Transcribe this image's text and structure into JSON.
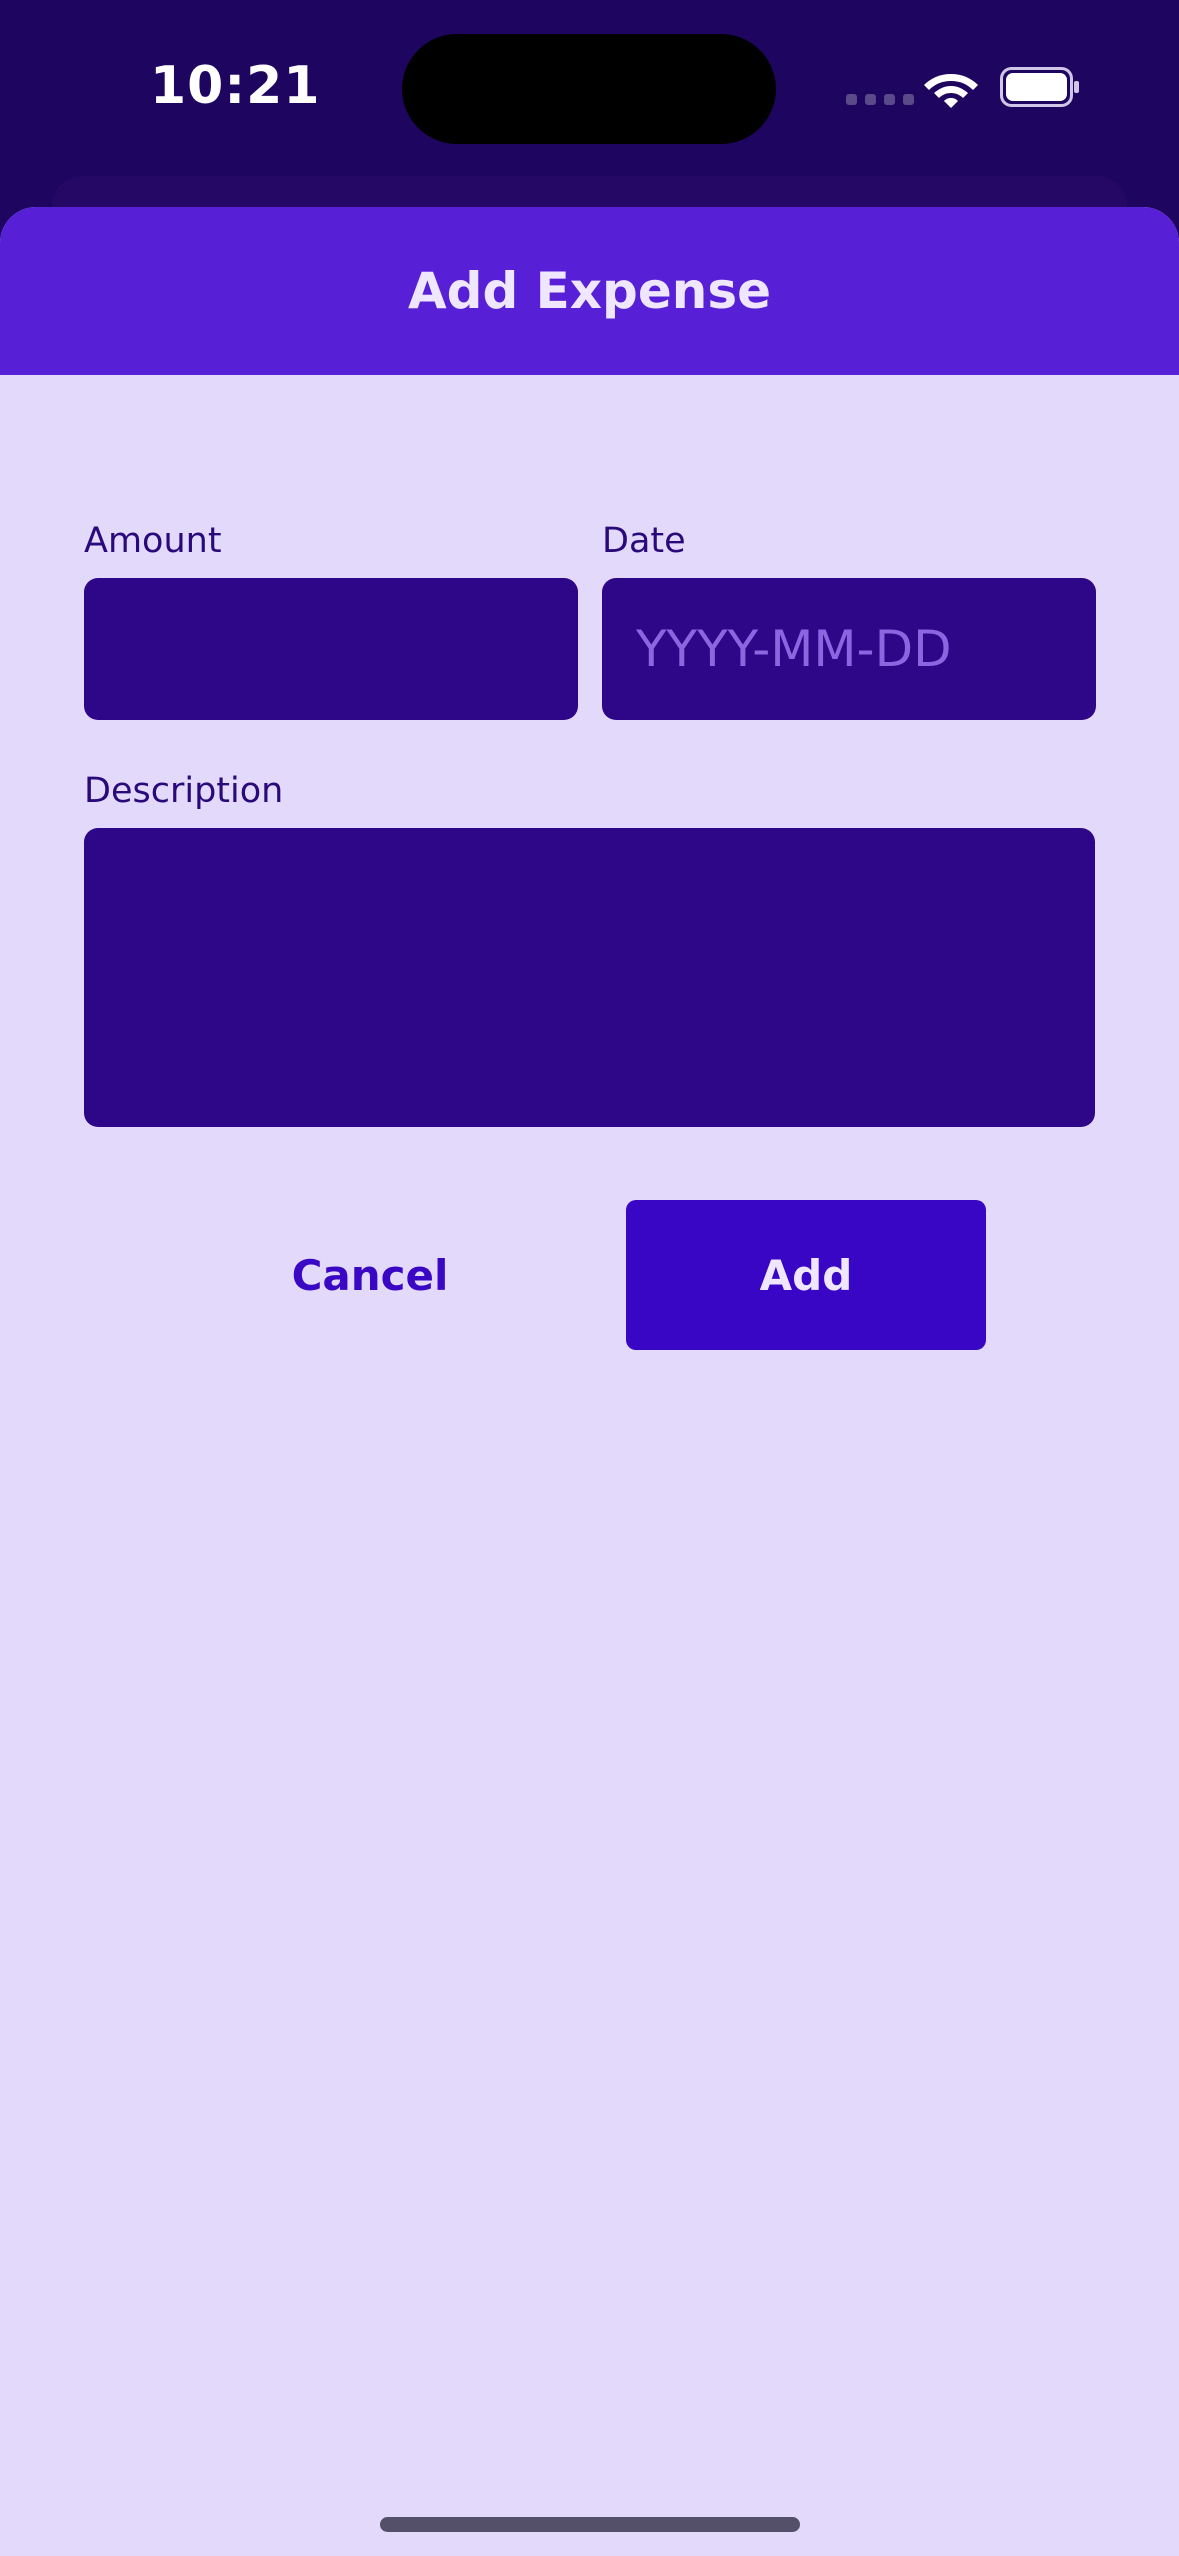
{
  "status_bar": {
    "time": "10:21",
    "wifi_icon": "wifi-icon",
    "battery_icon": "battery-icon"
  },
  "sheet": {
    "title": "Add Expense"
  },
  "form": {
    "amount": {
      "label": "Amount",
      "value": "",
      "placeholder": ""
    },
    "date": {
      "label": "Date",
      "value": "",
      "placeholder": "YYYY-MM-DD"
    },
    "description": {
      "label": "Description",
      "value": "",
      "placeholder": ""
    }
  },
  "actions": {
    "cancel_label": "Cancel",
    "add_label": "Add"
  },
  "colors": {
    "background": "#1e0560",
    "header": "#5820d6",
    "sheet": "#e3dafb",
    "field": "#2d0787",
    "primary_button": "#3a06c6",
    "label_text": "#2a0a7a"
  }
}
